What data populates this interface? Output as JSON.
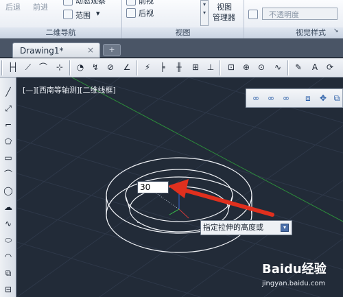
{
  "ribbon": {
    "nav_panel": {
      "back": "后退",
      "forward": "前进",
      "partial": "动态观察",
      "extent": "范围",
      "title": "二维导航"
    },
    "view_panel": {
      "front": "前视",
      "back_view": "后视",
      "manager_line1": "视图",
      "manager_line2": "管理器",
      "title": "视图"
    },
    "visual_panel": {
      "opacity": "不透明度",
      "title": "视觉样式"
    }
  },
  "tabs": {
    "drawing_tab": "Drawing1*",
    "close_glyph": "×",
    "new_tab_glyph": "+"
  },
  "viewport": {
    "label": "[—][西南等轴测][二维线框]",
    "input_value": "30",
    "prompt": "指定拉伸的高度或"
  },
  "watermark": {
    "logo": "Baidu经验",
    "url": "jingyan.baidu.com"
  },
  "colors": {
    "viewport_bg": "#222b38",
    "arrow": "#e0301e",
    "prompt_bg": "#eef1f5"
  }
}
